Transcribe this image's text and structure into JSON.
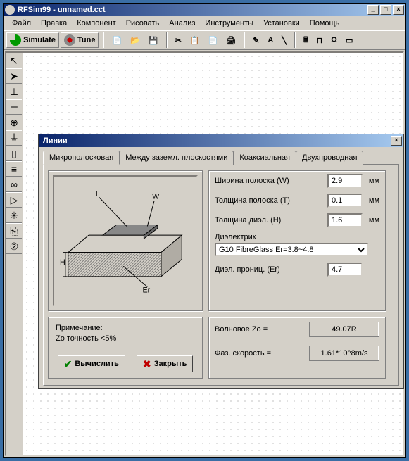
{
  "app": {
    "title": "RFSim99 - unnamed.cct",
    "window_controls": {
      "minimize": "_",
      "maximize": "□",
      "close": "×"
    }
  },
  "menu": [
    "Файл",
    "Правка",
    "Компонент",
    "Рисовать",
    "Анализ",
    "Инструменты",
    "Установки",
    "Помощь"
  ],
  "toolbar": {
    "simulate": "Simulate",
    "tune": "Tune"
  },
  "dialog": {
    "title": "Линии",
    "close": "×",
    "tabs": [
      "Микрополосковая",
      "Между заземл. плоскостями",
      "Коаксиальная",
      "Двухпроводная"
    ],
    "diagram": {
      "T": "T",
      "W": "W",
      "H": "H",
      "Er": "Er"
    },
    "inputs": {
      "width_label": "Ширина полоска (W)",
      "width_value": "2.9",
      "width_unit": "мм",
      "thick_label": "Толщина полоска (T)",
      "thick_value": "0.1",
      "thick_unit": "мм",
      "diel_label": "Толщина диэл. (H)",
      "diel_value": "1.6",
      "diel_unit": "мм",
      "mat_label": "Диэлектрик",
      "mat_value": "G10 FibreGlass Er=3.8~4.8",
      "er_label": "Диэл. прониц. (Er)",
      "er_value": "4.7"
    },
    "note": {
      "line1": "Примечание:",
      "line2": "Zo точность <5%"
    },
    "buttons": {
      "calc": "Вычислить",
      "close": "Закрыть"
    },
    "results": {
      "zo_label": "Волновое Zo =",
      "zo_value": "49.07R",
      "vp_label": "Фаз. скорость = ",
      "vp_value": "1.61*10^8m/s"
    }
  }
}
